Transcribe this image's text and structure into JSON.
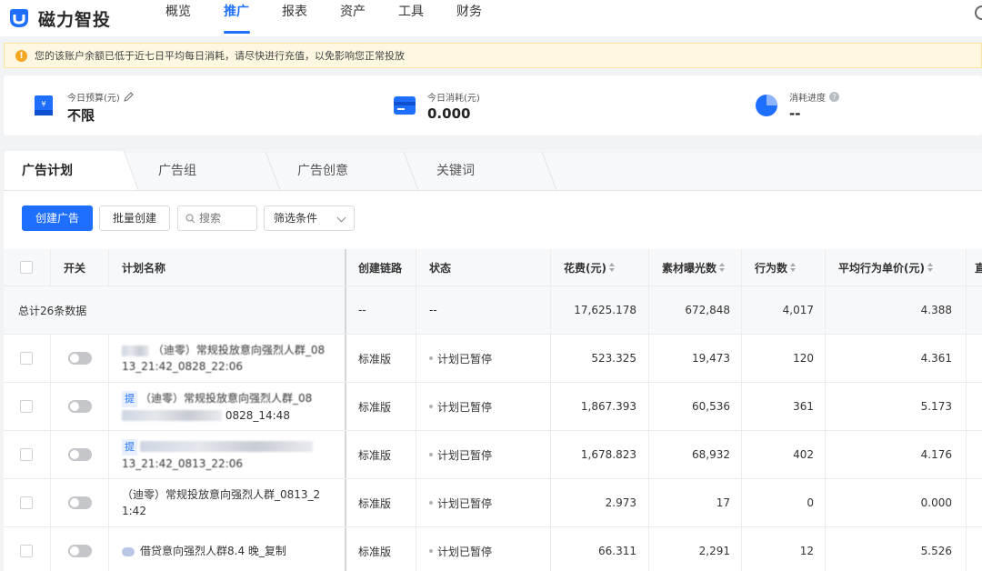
{
  "app": {
    "name": "磁力智投"
  },
  "nav": [
    {
      "label": "概览",
      "active": false
    },
    {
      "label": "推广",
      "active": true
    },
    {
      "label": "报表",
      "active": false
    },
    {
      "label": "资产",
      "active": false
    },
    {
      "label": "工具",
      "active": false
    },
    {
      "label": "财务",
      "active": false
    }
  ],
  "warning": {
    "text": "您的该账户余额已低于近七日平均每日消耗，请尽快进行充值，以免影响您正常投放"
  },
  "stats": {
    "budget": {
      "label": "今日预算(元)",
      "value": "不限"
    },
    "spend": {
      "label": "今日消耗(元)",
      "value": "0.000"
    },
    "progress": {
      "label": "消耗进度",
      "value": "--"
    }
  },
  "tabs": [
    {
      "label": "广告计划",
      "active": true
    },
    {
      "label": "广告组",
      "active": false
    },
    {
      "label": "广告创意",
      "active": false
    },
    {
      "label": "关键词",
      "active": false
    }
  ],
  "toolbar": {
    "create": "创建广告",
    "batch_create": "批量创建",
    "search_placeholder": "搜索",
    "filter": "筛选条件"
  },
  "table": {
    "headers": {
      "switch": "开关",
      "name": "计划名称",
      "chain": "创建链路",
      "status": "状态",
      "cost": "花费(元)",
      "impressions": "素材曝光数",
      "actions": "行为数",
      "avg_cost": "平均行为单价(元)",
      "next": "直"
    },
    "summary": {
      "label": "总计26条数据",
      "chain": "--",
      "status": "--",
      "cost": "17,625.178",
      "impressions": "672,848",
      "actions": "4,017",
      "avg_cost": "4.388"
    },
    "rows": [
      {
        "name_line1": "（迪零）常规投放意向强烈人群_08",
        "name_line2": "13_21:42_0828_22:06",
        "chain": "标准版",
        "status": "计划已暂停",
        "cost": "523.325",
        "impressions": "19,473",
        "actions": "120",
        "avg_cost": "4.361"
      },
      {
        "tag": "提",
        "name_line1": "（迪零）常规投放意向强烈人群_08",
        "name_line2": "0828_14:48",
        "chain": "标准版",
        "status": "计划已暂停",
        "cost": "1,867.393",
        "impressions": "60,536",
        "actions": "361",
        "avg_cost": "5.173"
      },
      {
        "tag": "提",
        "name_line1": "",
        "name_line2": "13_21:42_0813_22:06",
        "chain": "标准版",
        "status": "计划已暂停",
        "cost": "1,678.823",
        "impressions": "68,932",
        "actions": "402",
        "avg_cost": "4.176"
      },
      {
        "name_line1": "（迪零）常规投放意向强烈人群_0813_2",
        "name_line2": "1:42",
        "chain": "标准版",
        "status": "计划已暂停",
        "cost": "2.973",
        "impressions": "17",
        "actions": "0",
        "avg_cost": "0.000"
      },
      {
        "name_line1": "借贷意向强烈人群8.4 晚_复制",
        "name_line2": "",
        "chain": "标准版",
        "status": "计划已暂停",
        "cost": "66.311",
        "impressions": "2,291",
        "actions": "12",
        "avg_cost": "5.526"
      }
    ]
  }
}
